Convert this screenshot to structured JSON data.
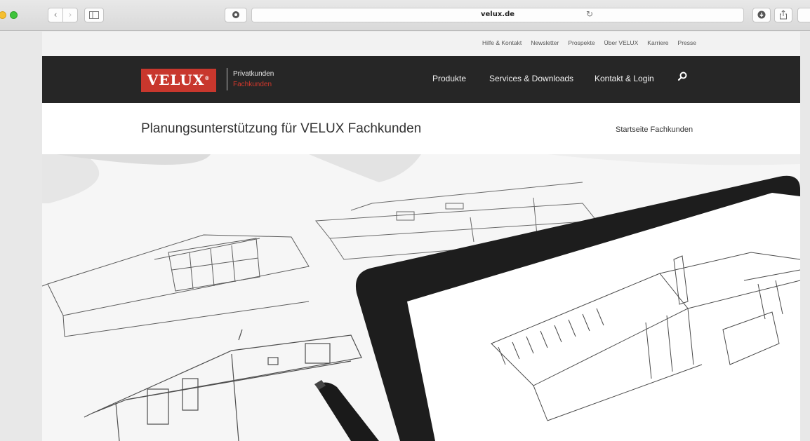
{
  "browser": {
    "url": "velux.de",
    "back_icon": "chevron-left-icon",
    "forward_icon": "chevron-right-icon",
    "sidebar_icon": "sidebar-icon",
    "reload_icon": "reload-icon",
    "download_icon": "download-icon",
    "share_icon": "share-icon"
  },
  "meta_nav": {
    "items": [
      "Hilfe & Kontakt",
      "Newsletter",
      "Prospekte",
      "Über VELUX",
      "Karriere",
      "Presse"
    ]
  },
  "header": {
    "logo_text": "VELUX",
    "logo_reg": "®",
    "segments": {
      "private": "Privatkunden",
      "professional": "Fachkunden"
    },
    "nav": {
      "products": "Produkte",
      "services": "Services & Downloads",
      "contact": "Kontakt & Login"
    },
    "search_icon": "search-icon"
  },
  "content": {
    "title": "Planungsunterstützung für VELUX Fachkunden",
    "home_link": "Startseite Fachkunden"
  },
  "colors": {
    "brand_red": "#c8372d",
    "header_bg": "#262626",
    "meta_bg": "#f2f2f2"
  }
}
